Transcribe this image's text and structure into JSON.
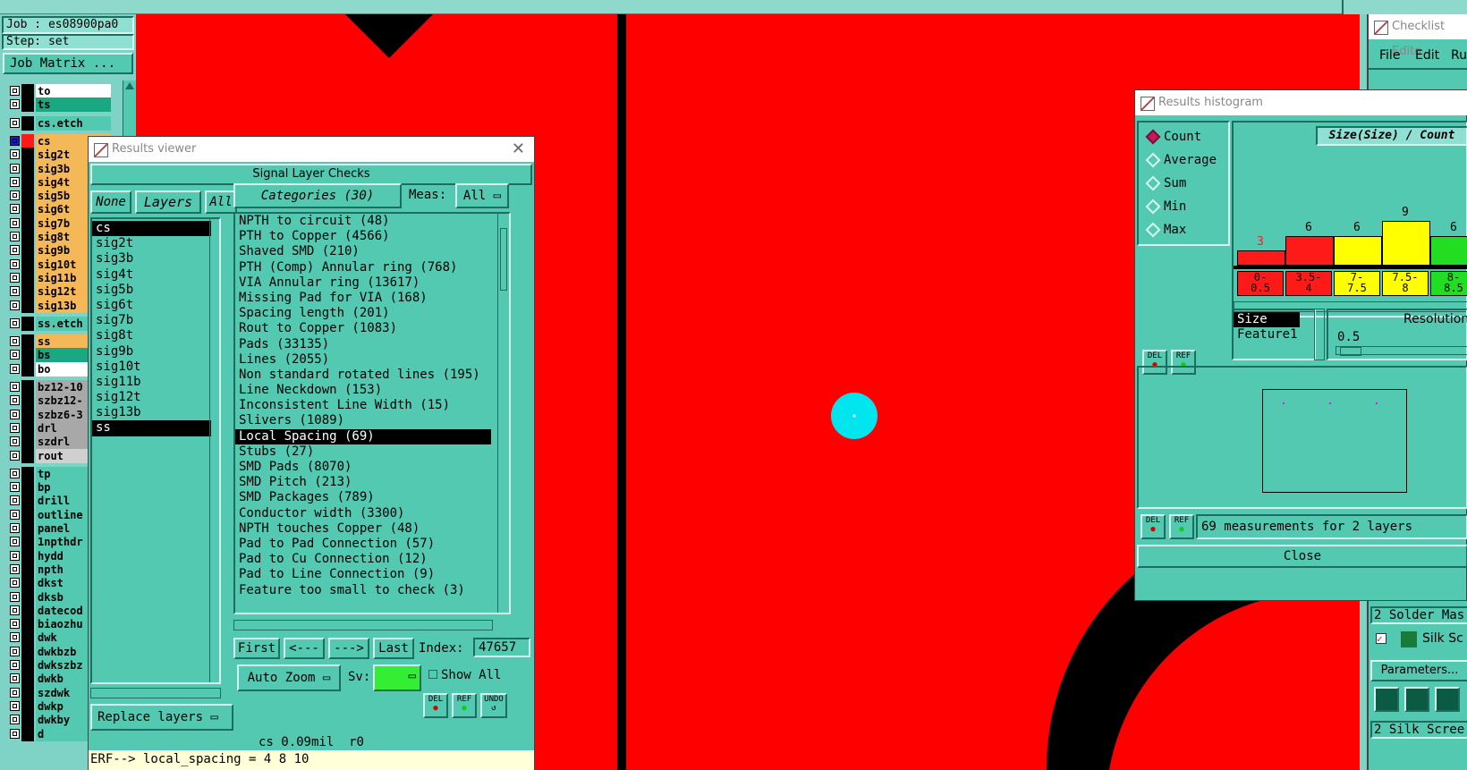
{
  "job": {
    "job_label": "Job : es08900pa0",
    "step_label": "Step: set",
    "matrix_button": "Job Matrix ..."
  },
  "layers": [
    {
      "name": "to",
      "bg": "#ffffff"
    },
    {
      "name": "ts",
      "bg": "#1aa882"
    },
    {
      "gap": true
    },
    {
      "name": "cs.etch",
      "bg": "#52c9b0"
    },
    {
      "gap": true
    },
    {
      "name": "cs",
      "bg": "#f4b858",
      "active": true
    },
    {
      "name": "sig2t",
      "bg": "#f4b858"
    },
    {
      "name": "sig3b",
      "bg": "#f4b858"
    },
    {
      "name": "sig4t",
      "bg": "#f4b858"
    },
    {
      "name": "sig5b",
      "bg": "#f4b858"
    },
    {
      "name": "sig6t",
      "bg": "#f4b858"
    },
    {
      "name": "sig7b",
      "bg": "#f4b858"
    },
    {
      "name": "sig8t",
      "bg": "#f4b858"
    },
    {
      "name": "sig9b",
      "bg": "#f4b858"
    },
    {
      "name": "sig10t",
      "bg": "#f4b858"
    },
    {
      "name": "sig11b",
      "bg": "#f4b858"
    },
    {
      "name": "sig12t",
      "bg": "#f4b858"
    },
    {
      "name": "sig13b",
      "bg": "#f4b858"
    },
    {
      "gap": true
    },
    {
      "name": "ss.etch",
      "bg": "#52c9b0"
    },
    {
      "gap": true
    },
    {
      "name": "ss",
      "bg": "#f4b858"
    },
    {
      "name": "bs",
      "bg": "#1aa882"
    },
    {
      "name": "bo",
      "bg": "#ffffff"
    },
    {
      "gap": true
    },
    {
      "name": "bz12-10",
      "bg": "#a8a8a8"
    },
    {
      "name": "szbz12-",
      "bg": "#a8a8a8"
    },
    {
      "name": "szbz6-3",
      "bg": "#a8a8a8"
    },
    {
      "name": "drl",
      "bg": "#a8a8a8"
    },
    {
      "name": "szdrl",
      "bg": "#a8a8a8"
    },
    {
      "name": "rout",
      "bg": "#d0d0d0"
    },
    {
      "gap": true
    },
    {
      "name": "tp",
      "bg": "#52c9b0"
    },
    {
      "name": "bp",
      "bg": "#52c9b0"
    },
    {
      "name": "drill",
      "bg": "#52c9b0"
    },
    {
      "name": "outline",
      "bg": "#52c9b0"
    },
    {
      "name": "panel",
      "bg": "#52c9b0"
    },
    {
      "name": "1npthdr",
      "bg": "#52c9b0"
    },
    {
      "name": "hydd",
      "bg": "#52c9b0"
    },
    {
      "name": "npth",
      "bg": "#52c9b0"
    },
    {
      "name": "dkst",
      "bg": "#52c9b0"
    },
    {
      "name": "dksb",
      "bg": "#52c9b0"
    },
    {
      "name": "datecod",
      "bg": "#52c9b0"
    },
    {
      "name": "biaozhu",
      "bg": "#52c9b0"
    },
    {
      "name": "dwk",
      "bg": "#52c9b0"
    },
    {
      "name": "dwkbzb",
      "bg": "#52c9b0"
    },
    {
      "name": "dwkszbz",
      "bg": "#52c9b0"
    },
    {
      "name": "dwkb",
      "bg": "#52c9b0"
    },
    {
      "name": "szdwk",
      "bg": "#52c9b0"
    },
    {
      "name": "dwkp",
      "bg": "#52c9b0"
    },
    {
      "name": "dwkby",
      "bg": "#52c9b0"
    },
    {
      "name": "d",
      "bg": "#52c9b0"
    }
  ],
  "results_viewer": {
    "title": "Results viewer",
    "header": "Signal Layer Checks",
    "none_btn": "None",
    "layers_btn": "Layers",
    "all_btn": "All",
    "categories_btn": "Categories (30)",
    "meas_label": "Meas:",
    "meas_value": "All",
    "layer_items": [
      "cs",
      "sig2t",
      "sig3b",
      "sig4t",
      "sig5b",
      "sig6t",
      "sig7b",
      "sig8t",
      "sig9b",
      "sig10t",
      "sig11b",
      "sig12t",
      "sig13b",
      "ss"
    ],
    "selected_layers": [
      "cs",
      "ss"
    ],
    "categories": [
      "NPTH to circuit (48)",
      "PTH to Copper (4566)",
      "Shaved SMD (210)",
      "PTH (Comp) Annular ring (768)",
      "VIA Annular ring (13617)",
      "Missing Pad for VIA (168)",
      "Spacing length (201)",
      "Rout to Copper (1083)",
      "Pads (33135)",
      "Lines (2055)",
      "Non standard rotated lines (195)",
      "Line Neckdown (153)",
      "Inconsistent Line Width (15)",
      "Slivers (1089)",
      "Local Spacing (69)",
      "Stubs (27)",
      "SMD Pads (8070)",
      "SMD Pitch (213)",
      "SMD Packages (789)",
      "Conductor width (3300)",
      "NPTH touches Copper (48)",
      "Pad to Pad Connection (57)",
      "Pad to Cu Connection (12)",
      "Pad to Line Connection (9)",
      "Feature too small to check (3)"
    ],
    "selected_category": "Local Spacing (69)",
    "nav": {
      "first": "First",
      "prev": "<---",
      "next": "--->",
      "last": "Last",
      "index_label": "Index:",
      "index_value": "47657"
    },
    "auto_zoom": "Auto Zoom",
    "sv_label": "Sv:",
    "show_all": "Show All",
    "replace_layers": "Replace layers",
    "del": "DEL",
    "ref": "REF",
    "undo": "UNDO",
    "status": "cs 0.09mil  r0",
    "command": "ERF--> local_spacing = 4 8 10"
  },
  "histogram": {
    "title": "Results histogram",
    "modes": [
      "Count",
      "Average",
      "Sum",
      "Min",
      "Max"
    ],
    "selected_mode": "Count",
    "axis_title": "Size(Size) / Count",
    "attr_items": [
      "Size",
      "Feature1"
    ],
    "resolution_label": "Resolution",
    "resolution_value": "0.5",
    "summary": "69 measurements for 2 layers",
    "close": "Close",
    "del": "DEL",
    "ref": "REF"
  },
  "chart_data": {
    "type": "bar",
    "title": "Size(Size) / Count",
    "categories": [
      "0-\n0.5",
      "3.5-\n4",
      "7-\n7.5",
      "7.5-\n8",
      "8-\n8.5"
    ],
    "values": [
      3,
      6,
      6,
      9,
      6
    ],
    "colors": [
      "#ff1a1a",
      "#ff1a1a",
      "#ffff00",
      "#ffff00",
      "#22dd22"
    ],
    "value_label_colors": [
      "#ff1a1a",
      "#000000",
      "#000000",
      "#000000",
      "#000000"
    ],
    "ylim": [
      0,
      9
    ]
  },
  "checklist": {
    "title": "Checklist Edito",
    "menu": [
      "File",
      "Edit",
      "Ru"
    ],
    "row1": "2 Solder Mas",
    "row2": "Silk Sc",
    "parameters": "Parameters...",
    "row3": "2 Silk Scree"
  }
}
